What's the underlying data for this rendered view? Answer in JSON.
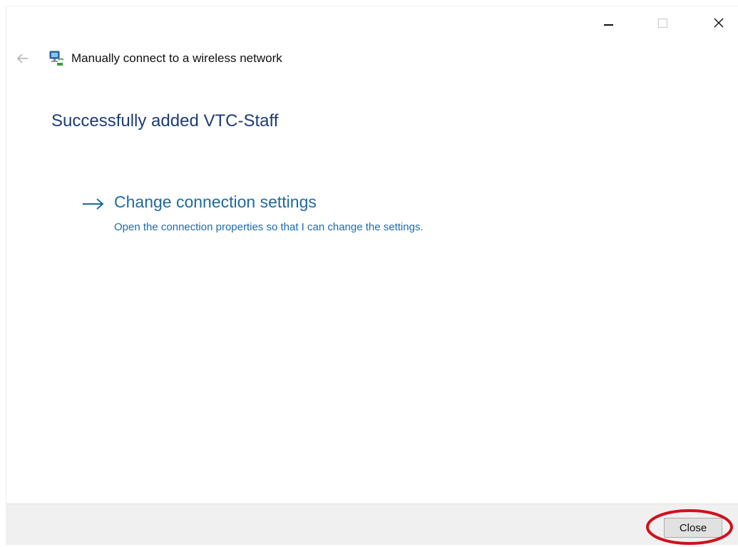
{
  "window": {
    "caption_buttons": {
      "minimize_icon": "minimize-icon",
      "maximize_icon": "maximize-icon",
      "close_icon": "close-icon"
    }
  },
  "nav": {
    "back_icon": "back-arrow-icon",
    "app_icon": "wireless-network-icon",
    "title": "Manually connect to a wireless network"
  },
  "main": {
    "heading": "Successfully added VTC-Staff",
    "change_settings": {
      "icon": "arrow-right-icon",
      "title": "Change connection settings",
      "description": "Open the connection properties so that I can change the settings."
    }
  },
  "footer": {
    "close_label": "Close"
  },
  "colors": {
    "heading": "#1d3c74",
    "link": "#1e6a9c",
    "footer_bg": "#f0f0f0",
    "highlight": "#d0101a"
  }
}
